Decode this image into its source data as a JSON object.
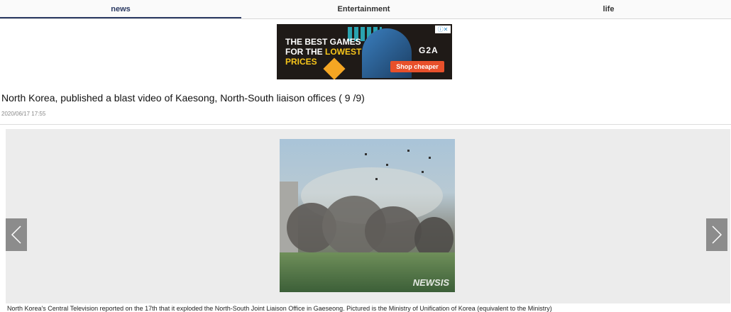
{
  "nav": {
    "tabs": [
      {
        "label": "news",
        "active": true
      },
      {
        "label": "Entertainment",
        "active": false
      },
      {
        "label": "life",
        "active": false
      }
    ]
  },
  "ad": {
    "line1": "THE BEST GAMES",
    "line2_prefix": "FOR THE ",
    "line2_highlight": "LOWEST",
    "line3": "PRICES",
    "brand": "G2A",
    "cta": "Shop cheaper",
    "badge": "ⓘ✕",
    "accent": "#f7c51b",
    "cta_color": "#e8502b"
  },
  "article": {
    "headline": "North Korea, published a blast video of Kaesong, North-South liaison offices ( 9 /9)",
    "date": "2020/06/17 17:55",
    "photo_watermark": "NEWSIS",
    "caption": "North Korea's Central Television reported on the 17th that it exploded the North-South Joint Liaison Office in Gaeseong. Pictured is the Ministry of Unification of Korea (equivalent to the Ministry)"
  }
}
